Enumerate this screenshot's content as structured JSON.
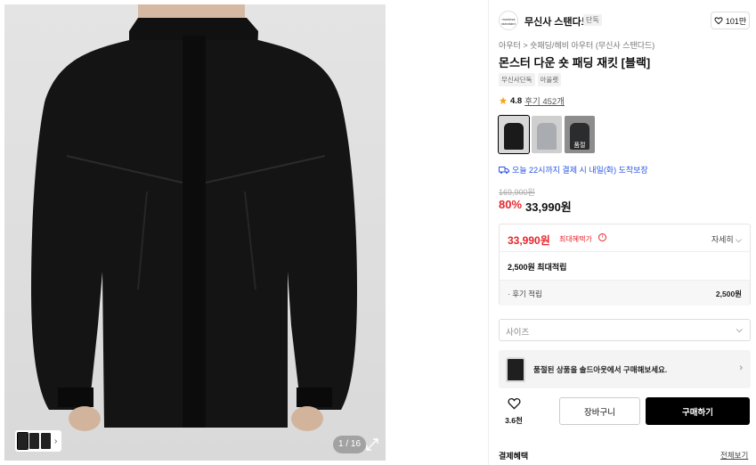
{
  "gallery": {
    "counter": "1 / 16",
    "thumbs": [
      "thumb-1",
      "thumb-2",
      "thumb-3"
    ]
  },
  "brand": {
    "logo_text": "musinsa standard",
    "name": "무신사 스탠다드",
    "tag": "단독",
    "likes": "101만"
  },
  "product": {
    "breadcrumb": "아우터 > 숏패딩/헤비 아우터 (무신사 스탠다드)",
    "title": "몬스터 다운 숏 패딩 재킷 [블랙]",
    "tags": [
      "무신사단독",
      "아울렛"
    ],
    "rating": "4.8",
    "reviews": "후기 452개",
    "swatch_soldout_label": "품절",
    "delivery": "오늘 22시까지 결제 시 내일(화) 도착보장",
    "original_price": "169,900원",
    "discount": "80%",
    "price": "33,990원"
  },
  "benefit": {
    "max_price": "33,990원",
    "max_label": "최대혜택가",
    "detail": "자세히",
    "points_title": "2,500원 최대적립",
    "review_points_label": "· 후기 적립",
    "review_points_value": "2,500원"
  },
  "size_select": {
    "placeholder": "사이즈"
  },
  "outlet": {
    "text": "품절된 상품을 솔드아웃에서 구매해보세요."
  },
  "actions": {
    "wish_count": "3.6천",
    "cart": "장바구니",
    "buy": "구매하기"
  },
  "payment": {
    "title": "결제혜택",
    "all": "전체보기"
  },
  "colors": {
    "accent_red": "#e5262c",
    "delivery_blue": "#2a56e3",
    "buy_button": "#000000"
  }
}
